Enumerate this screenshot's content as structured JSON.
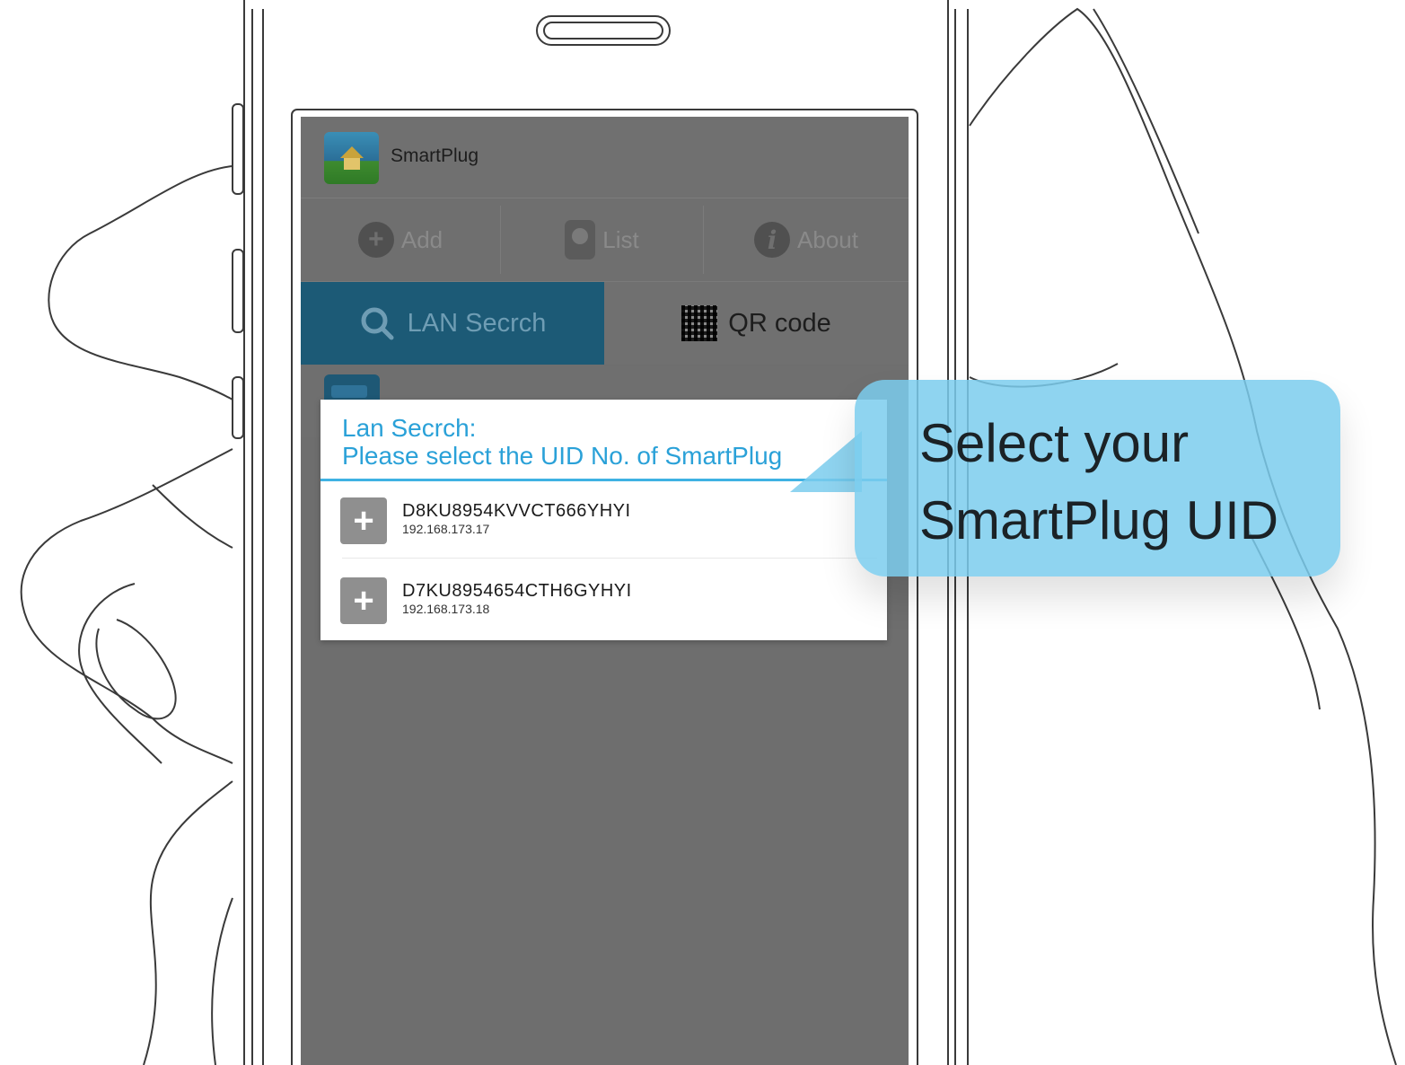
{
  "app": {
    "title": "SmartPlug"
  },
  "nav": {
    "items": [
      {
        "label": "Add",
        "icon": "plus-circle-icon"
      },
      {
        "label": "List",
        "icon": "plug-icon"
      },
      {
        "label": "About",
        "icon": "info-circle-icon"
      }
    ]
  },
  "tabs": {
    "lan_search": "LAN Secrch",
    "qr_code": "QR code"
  },
  "dialog": {
    "title_line1": "Lan Secrch:",
    "title_line2": "Please select the UID No. of SmartPlug",
    "devices": [
      {
        "uid": "D8KU8954KVVCT666YHYI",
        "ip": "192.168.173.17"
      },
      {
        "uid": "D7KU8954654CTH6GYHYI",
        "ip": "192.168.173.18"
      }
    ]
  },
  "callout": {
    "text": "Select your\nSmartPlug UID"
  },
  "colors": {
    "accent": "#2aa1d8",
    "tab_active": "#1c5a76",
    "callout": "#7bcded",
    "screen_overlay": "#6e6e6e"
  }
}
